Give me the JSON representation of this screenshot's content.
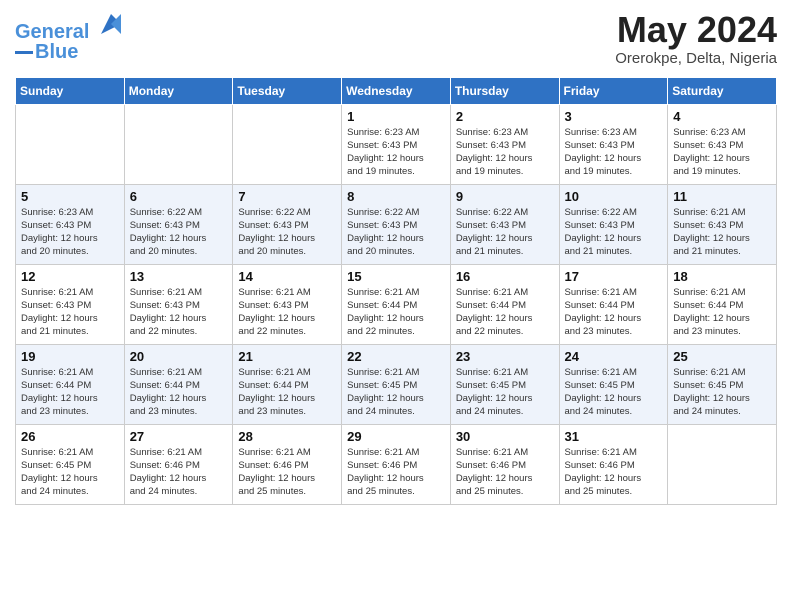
{
  "header": {
    "logo_line1": "General",
    "logo_line2": "Blue",
    "month": "May 2024",
    "location": "Orerokpe, Delta, Nigeria"
  },
  "days_of_week": [
    "Sunday",
    "Monday",
    "Tuesday",
    "Wednesday",
    "Thursday",
    "Friday",
    "Saturday"
  ],
  "weeks": [
    [
      {
        "day": "",
        "info": ""
      },
      {
        "day": "",
        "info": ""
      },
      {
        "day": "",
        "info": ""
      },
      {
        "day": "1",
        "info": "Sunrise: 6:23 AM\nSunset: 6:43 PM\nDaylight: 12 hours\nand 19 minutes."
      },
      {
        "day": "2",
        "info": "Sunrise: 6:23 AM\nSunset: 6:43 PM\nDaylight: 12 hours\nand 19 minutes."
      },
      {
        "day": "3",
        "info": "Sunrise: 6:23 AM\nSunset: 6:43 PM\nDaylight: 12 hours\nand 19 minutes."
      },
      {
        "day": "4",
        "info": "Sunrise: 6:23 AM\nSunset: 6:43 PM\nDaylight: 12 hours\nand 19 minutes."
      }
    ],
    [
      {
        "day": "5",
        "info": "Sunrise: 6:23 AM\nSunset: 6:43 PM\nDaylight: 12 hours\nand 20 minutes."
      },
      {
        "day": "6",
        "info": "Sunrise: 6:22 AM\nSunset: 6:43 PM\nDaylight: 12 hours\nand 20 minutes."
      },
      {
        "day": "7",
        "info": "Sunrise: 6:22 AM\nSunset: 6:43 PM\nDaylight: 12 hours\nand 20 minutes."
      },
      {
        "day": "8",
        "info": "Sunrise: 6:22 AM\nSunset: 6:43 PM\nDaylight: 12 hours\nand 20 minutes."
      },
      {
        "day": "9",
        "info": "Sunrise: 6:22 AM\nSunset: 6:43 PM\nDaylight: 12 hours\nand 21 minutes."
      },
      {
        "day": "10",
        "info": "Sunrise: 6:22 AM\nSunset: 6:43 PM\nDaylight: 12 hours\nand 21 minutes."
      },
      {
        "day": "11",
        "info": "Sunrise: 6:21 AM\nSunset: 6:43 PM\nDaylight: 12 hours\nand 21 minutes."
      }
    ],
    [
      {
        "day": "12",
        "info": "Sunrise: 6:21 AM\nSunset: 6:43 PM\nDaylight: 12 hours\nand 21 minutes."
      },
      {
        "day": "13",
        "info": "Sunrise: 6:21 AM\nSunset: 6:43 PM\nDaylight: 12 hours\nand 22 minutes."
      },
      {
        "day": "14",
        "info": "Sunrise: 6:21 AM\nSunset: 6:43 PM\nDaylight: 12 hours\nand 22 minutes."
      },
      {
        "day": "15",
        "info": "Sunrise: 6:21 AM\nSunset: 6:44 PM\nDaylight: 12 hours\nand 22 minutes."
      },
      {
        "day": "16",
        "info": "Sunrise: 6:21 AM\nSunset: 6:44 PM\nDaylight: 12 hours\nand 22 minutes."
      },
      {
        "day": "17",
        "info": "Sunrise: 6:21 AM\nSunset: 6:44 PM\nDaylight: 12 hours\nand 23 minutes."
      },
      {
        "day": "18",
        "info": "Sunrise: 6:21 AM\nSunset: 6:44 PM\nDaylight: 12 hours\nand 23 minutes."
      }
    ],
    [
      {
        "day": "19",
        "info": "Sunrise: 6:21 AM\nSunset: 6:44 PM\nDaylight: 12 hours\nand 23 minutes."
      },
      {
        "day": "20",
        "info": "Sunrise: 6:21 AM\nSunset: 6:44 PM\nDaylight: 12 hours\nand 23 minutes."
      },
      {
        "day": "21",
        "info": "Sunrise: 6:21 AM\nSunset: 6:44 PM\nDaylight: 12 hours\nand 23 minutes."
      },
      {
        "day": "22",
        "info": "Sunrise: 6:21 AM\nSunset: 6:45 PM\nDaylight: 12 hours\nand 24 minutes."
      },
      {
        "day": "23",
        "info": "Sunrise: 6:21 AM\nSunset: 6:45 PM\nDaylight: 12 hours\nand 24 minutes."
      },
      {
        "day": "24",
        "info": "Sunrise: 6:21 AM\nSunset: 6:45 PM\nDaylight: 12 hours\nand 24 minutes."
      },
      {
        "day": "25",
        "info": "Sunrise: 6:21 AM\nSunset: 6:45 PM\nDaylight: 12 hours\nand 24 minutes."
      }
    ],
    [
      {
        "day": "26",
        "info": "Sunrise: 6:21 AM\nSunset: 6:45 PM\nDaylight: 12 hours\nand 24 minutes."
      },
      {
        "day": "27",
        "info": "Sunrise: 6:21 AM\nSunset: 6:46 PM\nDaylight: 12 hours\nand 24 minutes."
      },
      {
        "day": "28",
        "info": "Sunrise: 6:21 AM\nSunset: 6:46 PM\nDaylight: 12 hours\nand 25 minutes."
      },
      {
        "day": "29",
        "info": "Sunrise: 6:21 AM\nSunset: 6:46 PM\nDaylight: 12 hours\nand 25 minutes."
      },
      {
        "day": "30",
        "info": "Sunrise: 6:21 AM\nSunset: 6:46 PM\nDaylight: 12 hours\nand 25 minutes."
      },
      {
        "day": "31",
        "info": "Sunrise: 6:21 AM\nSunset: 6:46 PM\nDaylight: 12 hours\nand 25 minutes."
      },
      {
        "day": "",
        "info": ""
      }
    ]
  ]
}
